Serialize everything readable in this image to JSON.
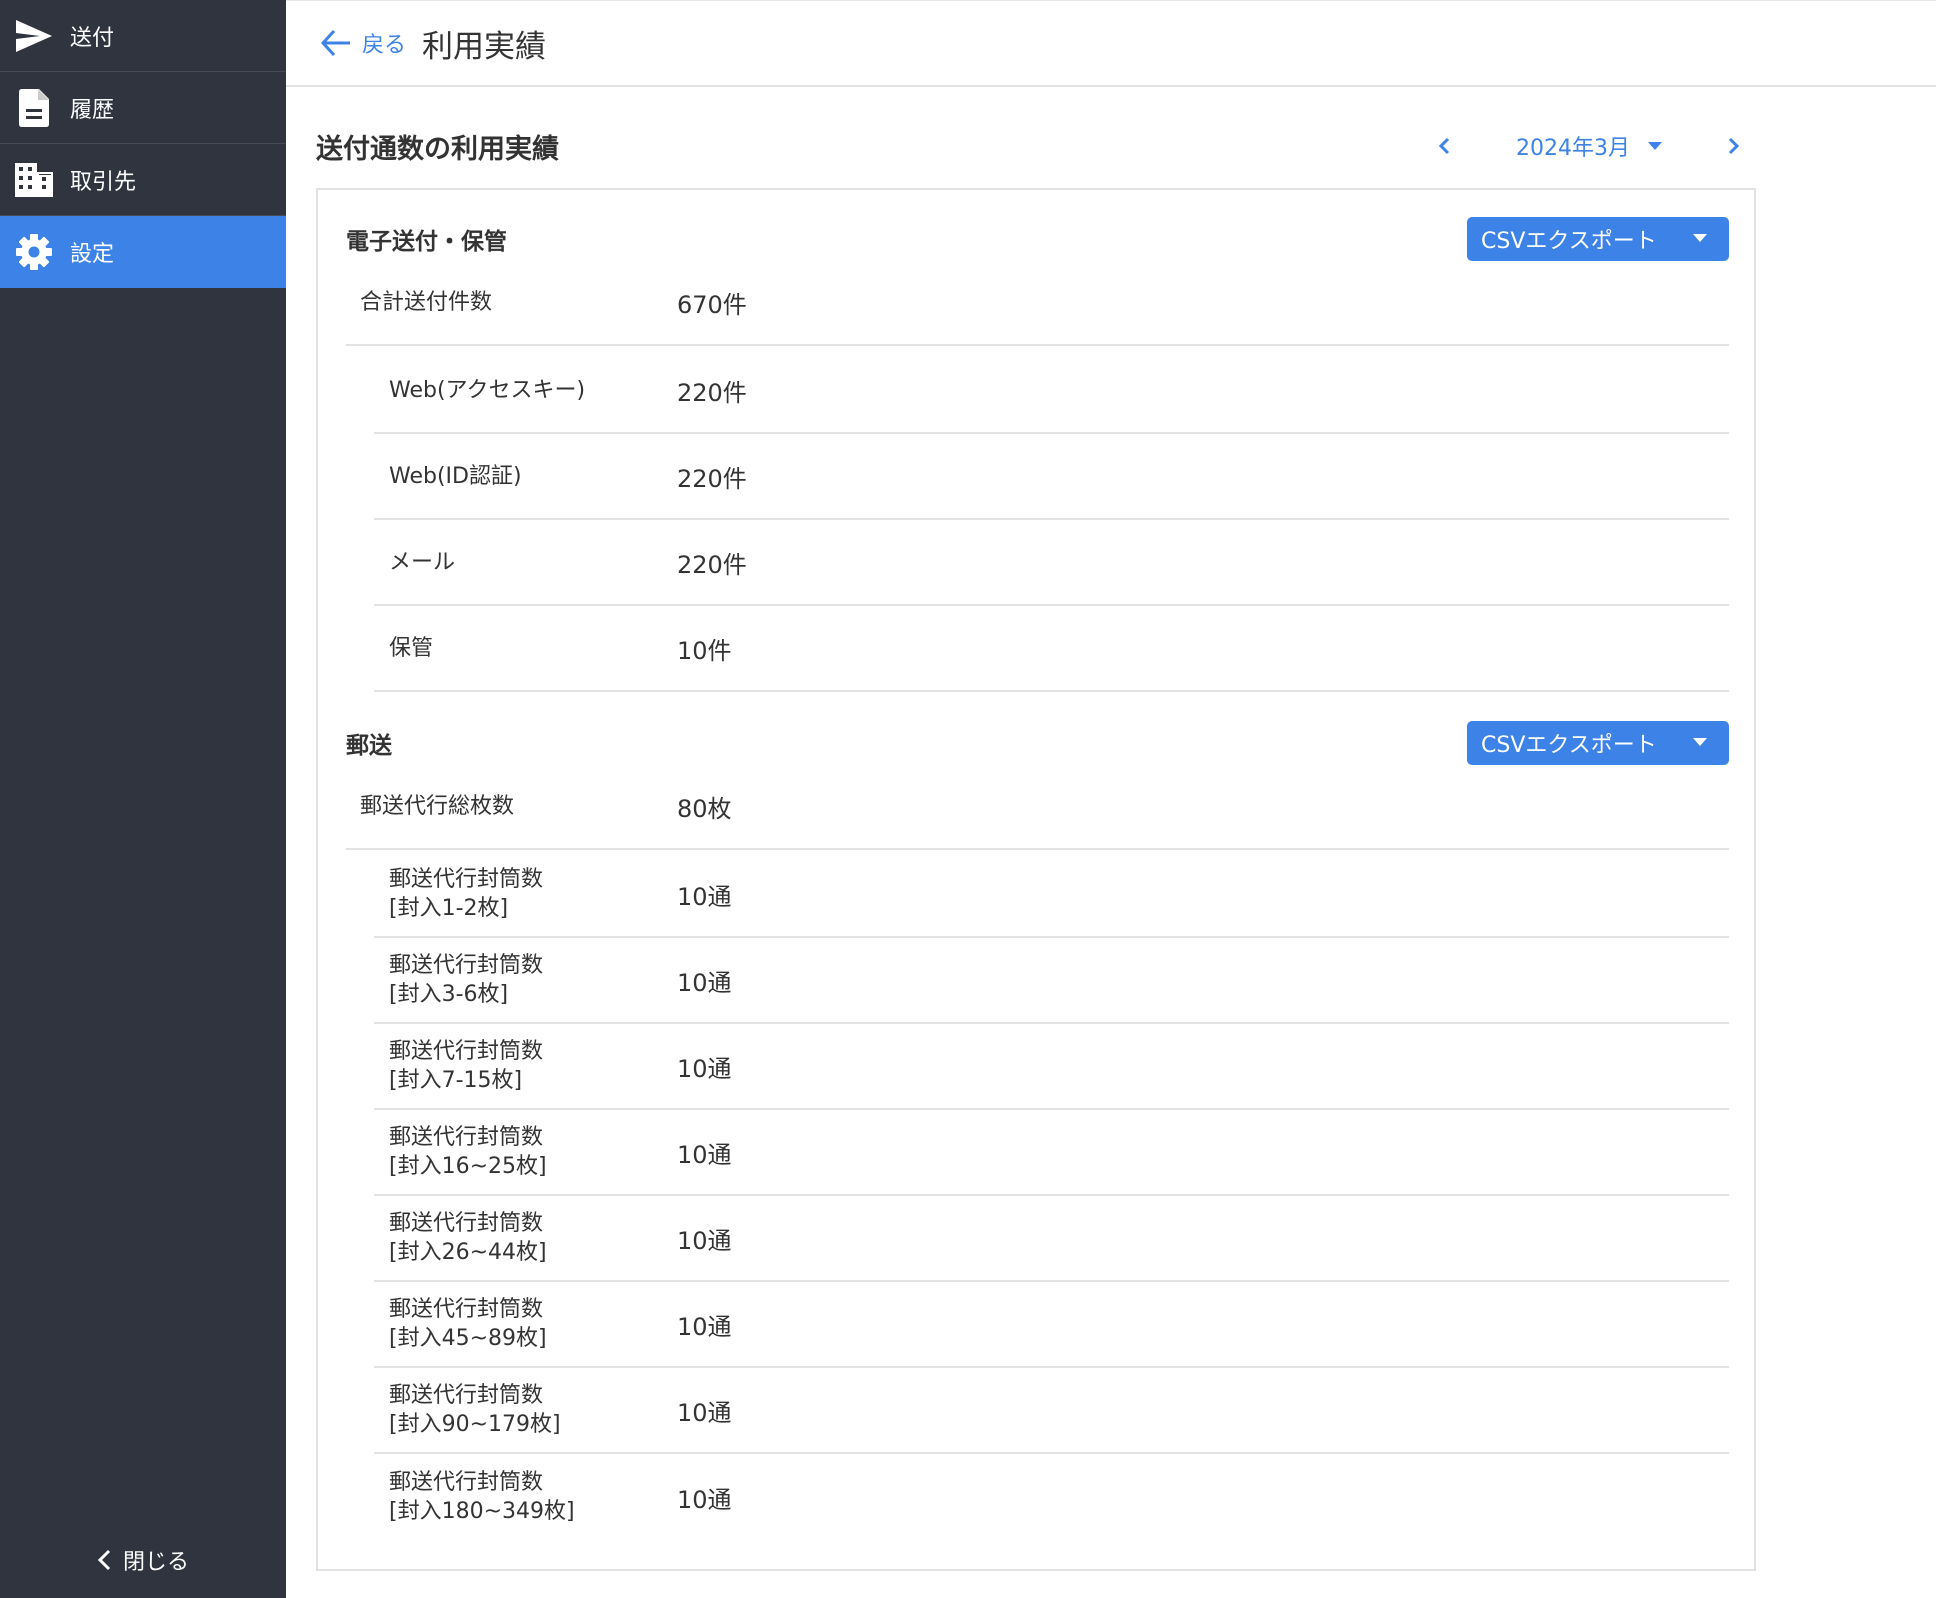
{
  "sidebar": {
    "items": [
      {
        "label": "送付",
        "icon": "send-icon"
      },
      {
        "label": "履歴",
        "icon": "document-icon"
      },
      {
        "label": "取引先",
        "icon": "building-icon"
      },
      {
        "label": "設定",
        "icon": "gear-icon"
      }
    ],
    "active_index": 3,
    "close_label": "閉じる"
  },
  "header": {
    "back_label": "戻る",
    "title": "利用実績"
  },
  "section": {
    "title": "送付通数の利用実績",
    "month_label": "2024年3月"
  },
  "electronic": {
    "title": "電子送付・保管",
    "csv_label": "CSVエクスポート",
    "total": {
      "label": "合計送付件数",
      "value": "670件"
    },
    "rows": [
      {
        "label": "Web(アクセスキー)",
        "value": "220件"
      },
      {
        "label": "Web(ID認証)",
        "value": "220件"
      },
      {
        "label": "メール",
        "value": "220件"
      },
      {
        "label": "保管",
        "value": "10件"
      }
    ]
  },
  "postal": {
    "title": "郵送",
    "csv_label": "CSVエクスポート",
    "total": {
      "label": "郵送代行総枚数",
      "value": "80枚"
    },
    "rows": [
      {
        "line1": "郵送代行封筒数",
        "line2": "[封入1-2枚]",
        "value": "10通"
      },
      {
        "line1": "郵送代行封筒数",
        "line2": "[封入3-6枚]",
        "value": "10通"
      },
      {
        "line1": "郵送代行封筒数",
        "line2": "[封入7-15枚]",
        "value": "10通"
      },
      {
        "line1": "郵送代行封筒数",
        "line2": "[封入16~25枚]",
        "value": "10通"
      },
      {
        "line1": "郵送代行封筒数",
        "line2": "[封入26~44枚]",
        "value": "10通"
      },
      {
        "line1": "郵送代行封筒数",
        "line2": "[封入45~89枚]",
        "value": "10通"
      },
      {
        "line1": "郵送代行封筒数",
        "line2": "[封入90~179枚]",
        "value": "10通"
      },
      {
        "line1": "郵送代行封筒数",
        "line2": "[封入180~349枚]",
        "value": "10通"
      }
    ]
  },
  "colors": {
    "sidebar_bg": "#2f343f",
    "accent": "#3d82e6",
    "divider": "#e2e2e2"
  }
}
